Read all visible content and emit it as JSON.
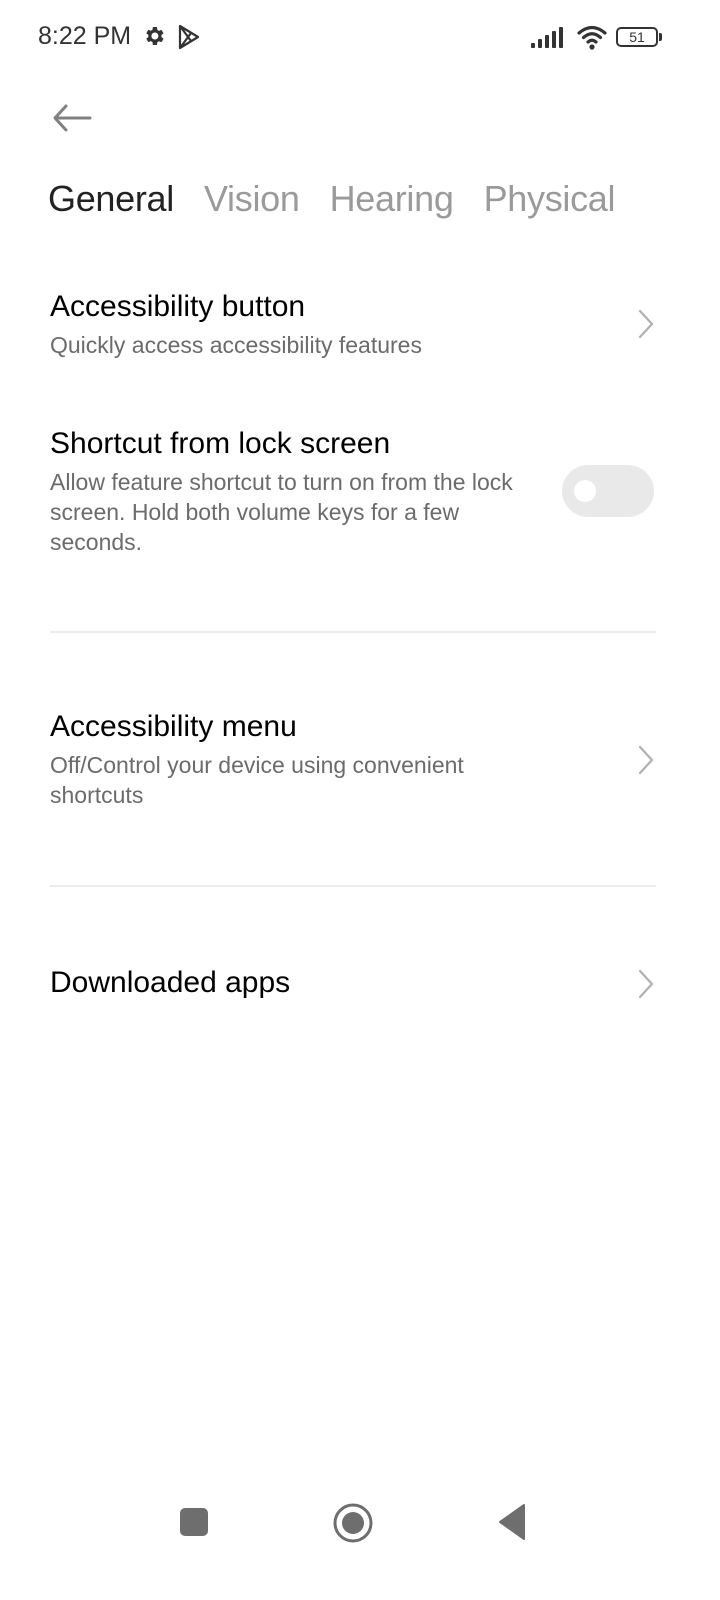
{
  "status_bar": {
    "time": "8:22 PM",
    "left_icons": [
      "settings-gear-icon",
      "play-store-icon"
    ],
    "right_icons": [
      "signal-icon",
      "wifi-icon",
      "battery-icon"
    ],
    "battery_level": "51"
  },
  "header": {
    "back_icon": "arrow-left-icon"
  },
  "tabs": [
    {
      "label": "General",
      "active": true
    },
    {
      "label": "Vision",
      "active": false
    },
    {
      "label": "Hearing",
      "active": false
    },
    {
      "label": "Physical",
      "active": false
    }
  ],
  "items": [
    {
      "title": "Accessibility button",
      "subtitle": "Quickly access accessibility features",
      "control": "chevron"
    },
    {
      "title": "Shortcut from lock screen",
      "subtitle": "Allow feature shortcut to turn on from the lock screen. Hold both volume keys for a few seconds.",
      "control": "toggle",
      "toggle_on": false
    },
    {
      "title": "Accessibility menu",
      "subtitle": "Off/Control your device using convenient shortcuts",
      "control": "chevron"
    },
    {
      "title": "Downloaded apps",
      "subtitle": "",
      "control": "chevron"
    }
  ],
  "nav_bar": {
    "buttons": [
      "recents",
      "home",
      "back"
    ]
  },
  "colors": {
    "toggle_off": "#e9e9e9",
    "subtitle": "#6b6b6b",
    "tab_inactive": "#9a9a9a"
  }
}
